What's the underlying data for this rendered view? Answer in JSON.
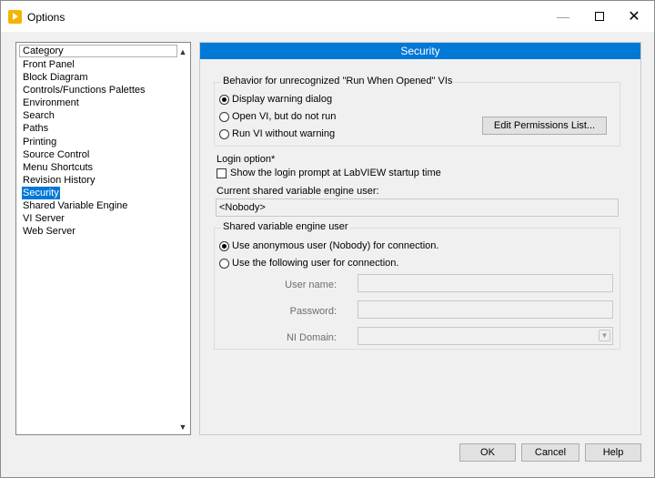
{
  "window": {
    "title": "Options",
    "icon": "labview-app-icon",
    "controls": {
      "minimize": "—",
      "maximize": "",
      "close": "✕"
    }
  },
  "sidebar": {
    "header": "Category",
    "items": [
      {
        "label": "Front Panel"
      },
      {
        "label": "Block Diagram"
      },
      {
        "label": "Controls/Functions Palettes"
      },
      {
        "label": "Environment"
      },
      {
        "label": "Search"
      },
      {
        "label": "Paths"
      },
      {
        "label": "Printing"
      },
      {
        "label": "Source Control"
      },
      {
        "label": "Menu Shortcuts"
      },
      {
        "label": "Revision History"
      },
      {
        "label": "Security",
        "selected": true
      },
      {
        "label": "Shared Variable Engine"
      },
      {
        "label": "VI Server"
      },
      {
        "label": "Web Server"
      }
    ],
    "scroll_up": "▲",
    "scroll_down": "▼"
  },
  "panel": {
    "title": "Security",
    "behavior_group": {
      "legend": "Behavior for unrecognized \"Run When Opened\" VIs",
      "options": [
        {
          "label": "Display warning dialog",
          "checked": true
        },
        {
          "label": "Open VI, but do not run",
          "checked": false
        },
        {
          "label": "Run VI without warning",
          "checked": false
        }
      ],
      "edit_permissions_button": "Edit Permissions List..."
    },
    "login": {
      "heading": "Login option*",
      "checkbox_label": "Show the login prompt at LabVIEW startup time",
      "checked": false
    },
    "current_user": {
      "label": "Current shared variable engine user:",
      "value": "<Nobody>"
    },
    "sve_group": {
      "legend": "Shared variable engine user",
      "options": [
        {
          "label": "Use anonymous user (Nobody) for connection.",
          "checked": true
        },
        {
          "label": "Use the following user for connection.",
          "checked": false
        }
      ],
      "username_label": "User name:",
      "username_value": "",
      "password_label": "Password:",
      "password_value": "",
      "domain_label": "NI Domain:",
      "domain_value": "",
      "domain_arrow": "▼"
    }
  },
  "footer": {
    "ok": "OK",
    "cancel": "Cancel",
    "help": "Help"
  }
}
